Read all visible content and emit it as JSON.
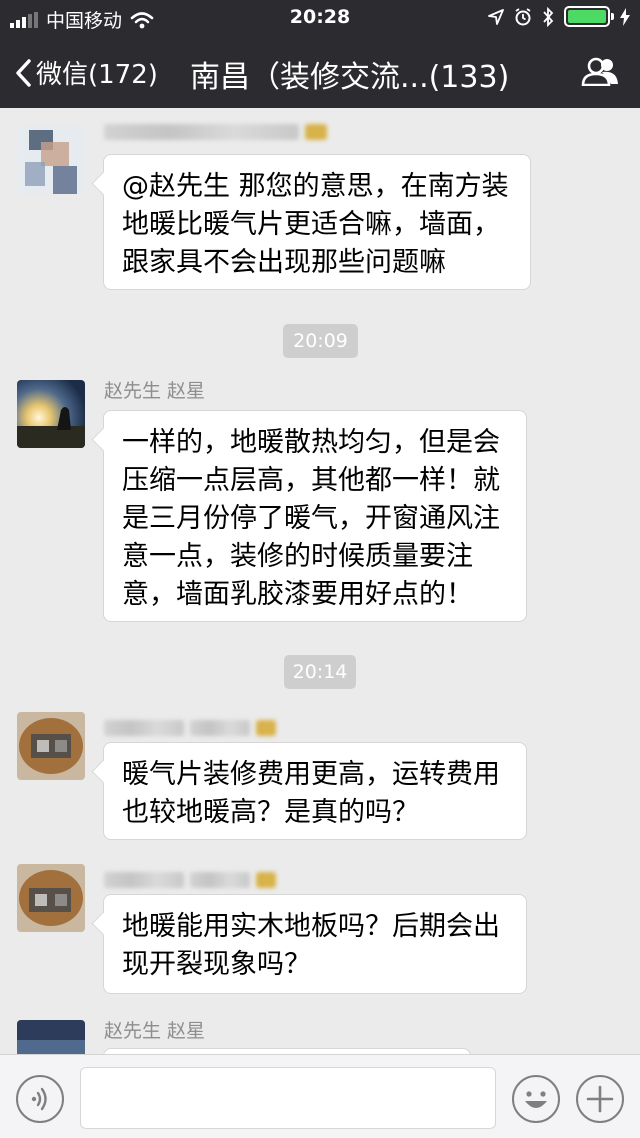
{
  "status_bar": {
    "carrier": "中国移动",
    "time": "20:28"
  },
  "nav": {
    "back_label": "微信(172)",
    "title": "南昌（装修交流...(133)"
  },
  "messages": [
    {
      "sender": "",
      "text_lines": [
        "@赵先生 那您的意思，在南方装",
        "地暖比暖气片更适合嘛，墙面，",
        "跟家具不会出现那些问题嘛"
      ]
    },
    {
      "sender": "赵先生 赵星",
      "text_lines": [
        "一样的，地暖散热均匀，但是会",
        "压缩一点层高，其他都一样！就",
        "是三月份停了暖气，开窗通风注",
        "意一点，装修的时候质量要注",
        "意，墙面乳胶漆要用好点的！"
      ]
    },
    {
      "sender": "",
      "text_lines": [
        "暖气片装修费用更高，运转费用",
        "也较地暖高？是真的吗？"
      ]
    },
    {
      "sender": "",
      "text_lines": [
        "地暖能用实木地板吗？后期会出",
        "现开裂现象吗？"
      ]
    },
    {
      "sender": "赵先生 赵星",
      "text_lines": []
    }
  ],
  "timestamps": [
    "20:09",
    "20:14"
  ],
  "colors": {
    "bar_bg": "#2b2b30",
    "chat_bg": "#ebebeb",
    "battery": "#4cd964"
  },
  "icons": {
    "back": "chevron-left-icon",
    "members": "group-icon",
    "voice": "voice-icon",
    "emoji": "emoji-icon",
    "more": "plus-icon"
  }
}
